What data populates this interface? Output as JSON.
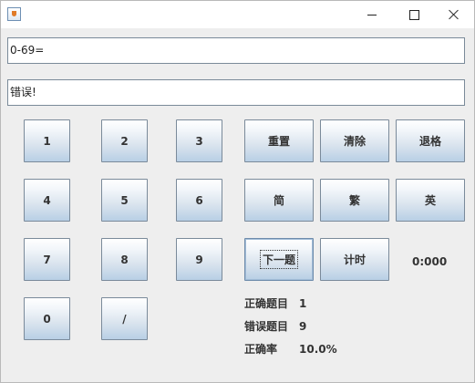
{
  "window": {
    "icon": "java-coffee-cup-icon",
    "controls": {
      "minimize_icon": "minimize-icon",
      "maximize_icon": "maximize-icon",
      "close_icon": "close-icon"
    }
  },
  "expression": {
    "value": "0-69="
  },
  "message": {
    "value": "错误!"
  },
  "keypad": {
    "keys": [
      "1",
      "2",
      "3",
      "4",
      "5",
      "6",
      "7",
      "8",
      "9",
      "0",
      "/"
    ]
  },
  "actions": {
    "reset": "重置",
    "clear": "清除",
    "backspace": "退格",
    "simplified": "简",
    "traditional": "繁",
    "english": "英",
    "next": "下一题",
    "timer": "计时"
  },
  "timer": {
    "display": "0:000"
  },
  "stats": {
    "correct_label": "正确题目",
    "correct_value": "1",
    "wrong_label": "错误题目",
    "wrong_value": "9",
    "rate_label": "正确率",
    "rate_value": "10.0%"
  },
  "colors": {
    "button_gradient_top": "#ffffff",
    "button_gradient_bottom": "#b8cfe5",
    "button_border": "#7a8a9a",
    "window_background": "#eeeeee"
  }
}
